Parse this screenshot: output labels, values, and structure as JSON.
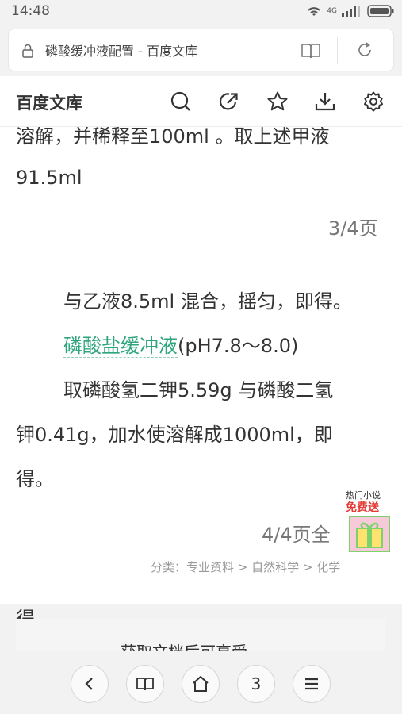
{
  "status_bar": {
    "time": "14:48",
    "network": "4G"
  },
  "browser": {
    "tab_title": "磷酸缓冲液配置 - 百度文库"
  },
  "app_header": {
    "logo": "百度文库"
  },
  "doc": {
    "card1": {
      "line1": "溶解，并稀释至100ml 。取上述甲液",
      "line2": "91.5ml",
      "page": "3/4页"
    },
    "card2": {
      "line1": "与乙液8.5ml 混合，摇匀，即得。",
      "link": "磷酸盐缓冲液",
      "line2_rest": "(pH7.8～8.0)",
      "line3": "取磷酸氢二钾5.59g 与磷酸二氢",
      "line4": "钾0.41g，加水使溶解成1000ml，即",
      "line5": "得。",
      "page": "4/4页全"
    },
    "category": "分类：专业资料 > 自然科学 > 化学",
    "promo": {
      "top": "热门小说",
      "free": "免费送"
    },
    "card3_text": "获取文档后可享受"
  },
  "bottom_nav": {
    "tab_count": "3"
  }
}
